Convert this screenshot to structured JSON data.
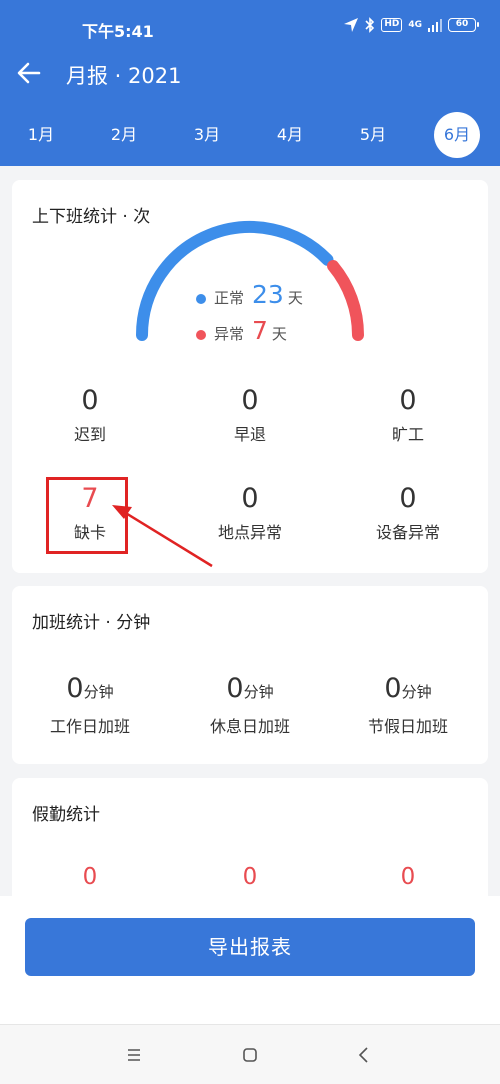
{
  "status_bar": {
    "time": "下午5:41",
    "hd": "HD",
    "network": "4G",
    "battery": "60"
  },
  "nav": {
    "title": "月报 · 2021"
  },
  "months": {
    "items": [
      "1月",
      "2月",
      "3月",
      "4月",
      "5月",
      "6月"
    ],
    "active": "6月"
  },
  "attendance": {
    "title": "上下班统计 · 次",
    "normal_label": "正常",
    "normal_value": "23",
    "normal_unit": "天",
    "abnormal_label": "异常",
    "abnormal_value": "7",
    "abnormal_unit": "天",
    "normal_fraction": 0.767,
    "stats": [
      {
        "value": "0",
        "label": "迟到"
      },
      {
        "value": "0",
        "label": "早退"
      },
      {
        "value": "0",
        "label": "旷工"
      },
      {
        "value": "7",
        "label": "缺卡"
      },
      {
        "value": "0",
        "label": "地点异常"
      },
      {
        "value": "0",
        "label": "设备异常"
      }
    ]
  },
  "overtime": {
    "title": "加班统计 · 分钟",
    "stats": [
      {
        "value": "0",
        "unit": "分钟",
        "label": "工作日加班"
      },
      {
        "value": "0",
        "unit": "分钟",
        "label": "休息日加班"
      },
      {
        "value": "0",
        "unit": "分钟",
        "label": "节假日加班"
      }
    ]
  },
  "leave": {
    "title": "假勤统计",
    "values": [
      "0",
      "0",
      "0"
    ]
  },
  "export": {
    "label": "导出报表"
  },
  "colors": {
    "primary": "#3877d9",
    "normal": "#3d8eea",
    "abnormal": "#f0545b",
    "highlight": "#e02323"
  },
  "icons": {
    "back": "arrow-left-icon",
    "location": "location-arrow-icon",
    "bluetooth": "bluetooth-icon",
    "signal": "signal-icon",
    "menu": "menu-icon",
    "home": "home-square-icon",
    "back_nav": "chevron-left-icon"
  }
}
